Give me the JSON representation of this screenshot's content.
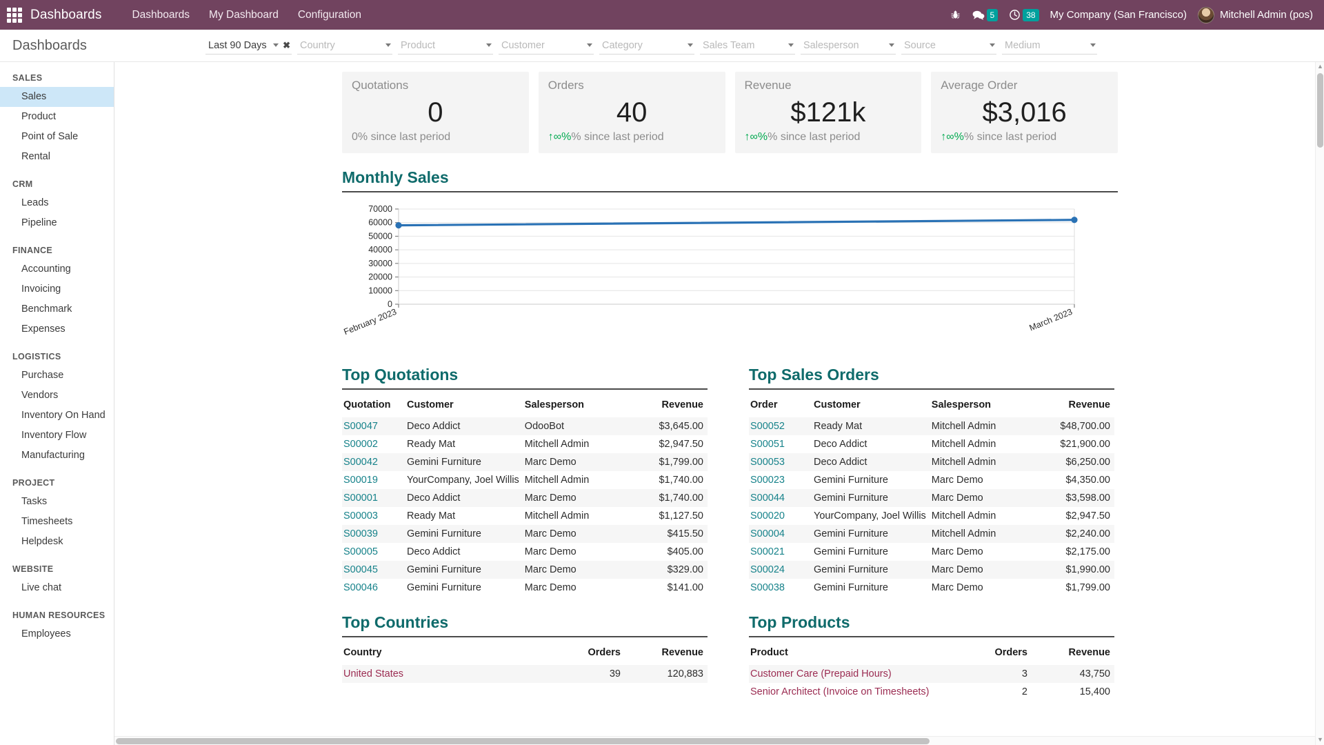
{
  "navbar": {
    "apps_icon": "apps-grid-icon",
    "brand": "Dashboards",
    "menu": [
      {
        "label": "Dashboards"
      },
      {
        "label": "My Dashboard"
      },
      {
        "label": "Configuration"
      }
    ],
    "bug_icon": "bug-icon",
    "messages_icon": "chat-bubble-icon",
    "messages_count": "5",
    "activities_icon": "clock-icon",
    "activities_count": "38",
    "company": "My Company (San Francisco)",
    "user": "Mitchell Admin (pos)",
    "avatar_icon": "user-avatar",
    "accent": "#71435f",
    "badge_color": "#00a09d"
  },
  "controlbar": {
    "title": "Dashboards",
    "period": {
      "value": "Last 90 Days"
    },
    "filters": [
      {
        "placeholder": "Country"
      },
      {
        "placeholder": "Product"
      },
      {
        "placeholder": "Customer"
      },
      {
        "placeholder": "Category"
      },
      {
        "placeholder": "Sales Team"
      },
      {
        "placeholder": "Salesperson"
      },
      {
        "placeholder": "Source"
      },
      {
        "placeholder": "Medium"
      }
    ]
  },
  "sidebar": {
    "groups": [
      {
        "label": "SALES",
        "items": [
          {
            "label": "Sales",
            "active": true
          },
          {
            "label": "Product",
            "active": false
          },
          {
            "label": "Point of Sale",
            "active": false
          },
          {
            "label": "Rental",
            "active": false
          }
        ]
      },
      {
        "label": "CRM",
        "items": [
          {
            "label": "Leads",
            "active": false
          },
          {
            "label": "Pipeline",
            "active": false
          }
        ]
      },
      {
        "label": "FINANCE",
        "items": [
          {
            "label": "Accounting",
            "active": false
          },
          {
            "label": "Invoicing",
            "active": false
          },
          {
            "label": "Benchmark",
            "active": false
          },
          {
            "label": "Expenses",
            "active": false
          }
        ]
      },
      {
        "label": "LOGISTICS",
        "items": [
          {
            "label": "Purchase",
            "active": false
          },
          {
            "label": "Vendors",
            "active": false
          },
          {
            "label": "Inventory On Hand",
            "active": false
          },
          {
            "label": "Inventory Flow",
            "active": false
          },
          {
            "label": "Manufacturing",
            "active": false
          }
        ]
      },
      {
        "label": "PROJECT",
        "items": [
          {
            "label": "Tasks",
            "active": false
          },
          {
            "label": "Timesheets",
            "active": false
          },
          {
            "label": "Helpdesk",
            "active": false
          }
        ]
      },
      {
        "label": "WEBSITE",
        "items": [
          {
            "label": "Live chat",
            "active": false
          }
        ]
      },
      {
        "label": "HUMAN RESOURCES",
        "items": [
          {
            "label": "Employees",
            "active": false
          }
        ]
      }
    ]
  },
  "kpis": [
    {
      "label": "Quotations",
      "value": "0",
      "delta": "0% since last period",
      "arrow": "",
      "positive": false
    },
    {
      "label": "Orders",
      "value": "40",
      "delta": "% since last period",
      "arrow": "↑∞",
      "positive": true
    },
    {
      "label": "Revenue",
      "value": "$121k",
      "delta": "% since last period",
      "arrow": "↑∞",
      "positive": true
    },
    {
      "label": "Average Order",
      "value": "$3,016",
      "delta": "% since last period",
      "arrow": "↑∞",
      "positive": true
    }
  ],
  "chart_data": {
    "type": "line",
    "title": "Monthly Sales",
    "x": [
      "February 2023",
      "March 2023"
    ],
    "categories": [
      "February 2023",
      "March 2023"
    ],
    "values": [
      58000,
      62000
    ],
    "series": [
      {
        "name": "Monthly Sales",
        "values": [
          58000,
          62000
        ]
      }
    ],
    "xlabel": "",
    "ylabel": "",
    "ylim": [
      0,
      70000
    ],
    "yticks": [
      0,
      10000,
      20000,
      30000,
      40000,
      50000,
      60000,
      70000
    ],
    "ytick_labels": [
      "0",
      "10000",
      "20000",
      "30000",
      "40000",
      "50000",
      "60000",
      "70000"
    ],
    "grid": true,
    "legend": false,
    "line_color": "#2a72b5",
    "marker": "circle"
  },
  "top_quotations": {
    "title": "Top Quotations",
    "columns": [
      "Quotation",
      "Customer",
      "Salesperson",
      "Revenue"
    ],
    "rows": [
      {
        "ref": "S00047",
        "customer": "Deco Addict",
        "salesperson": "OdooBot",
        "revenue": "$3,645.00"
      },
      {
        "ref": "S00002",
        "customer": "Ready Mat",
        "salesperson": "Mitchell Admin",
        "revenue": "$2,947.50"
      },
      {
        "ref": "S00042",
        "customer": "Gemini Furniture",
        "salesperson": "Marc Demo",
        "revenue": "$1,799.00"
      },
      {
        "ref": "S00019",
        "customer": "YourCompany, Joel Willis",
        "salesperson": "Mitchell Admin",
        "revenue": "$1,740.00"
      },
      {
        "ref": "S00001",
        "customer": "Deco Addict",
        "salesperson": "Marc Demo",
        "revenue": "$1,740.00"
      },
      {
        "ref": "S00003",
        "customer": "Ready Mat",
        "salesperson": "Mitchell Admin",
        "revenue": "$1,127.50"
      },
      {
        "ref": "S00039",
        "customer": "Gemini Furniture",
        "salesperson": "Marc Demo",
        "revenue": "$415.50"
      },
      {
        "ref": "S00005",
        "customer": "Deco Addict",
        "salesperson": "Marc Demo",
        "revenue": "$405.00"
      },
      {
        "ref": "S00045",
        "customer": "Gemini Furniture",
        "salesperson": "Marc Demo",
        "revenue": "$329.00"
      },
      {
        "ref": "S00046",
        "customer": "Gemini Furniture",
        "salesperson": "Marc Demo",
        "revenue": "$141.00"
      }
    ]
  },
  "top_sales_orders": {
    "title": "Top Sales Orders",
    "columns": [
      "Order",
      "Customer",
      "Salesperson",
      "Revenue"
    ],
    "rows": [
      {
        "ref": "S00052",
        "customer": "Ready Mat",
        "salesperson": "Mitchell Admin",
        "revenue": "$48,700.00"
      },
      {
        "ref": "S00051",
        "customer": "Deco Addict",
        "salesperson": "Mitchell Admin",
        "revenue": "$21,900.00"
      },
      {
        "ref": "S00053",
        "customer": "Deco Addict",
        "salesperson": "Mitchell Admin",
        "revenue": "$6,250.00"
      },
      {
        "ref": "S00023",
        "customer": "Gemini Furniture",
        "salesperson": "Marc Demo",
        "revenue": "$4,350.00"
      },
      {
        "ref": "S00044",
        "customer": "Gemini Furniture",
        "salesperson": "Marc Demo",
        "revenue": "$3,598.00"
      },
      {
        "ref": "S00020",
        "customer": "YourCompany, Joel Willis",
        "salesperson": "Mitchell Admin",
        "revenue": "$2,947.50"
      },
      {
        "ref": "S00004",
        "customer": "Gemini Furniture",
        "salesperson": "Mitchell Admin",
        "revenue": "$2,240.00"
      },
      {
        "ref": "S00021",
        "customer": "Gemini Furniture",
        "salesperson": "Marc Demo",
        "revenue": "$2,175.00"
      },
      {
        "ref": "S00024",
        "customer": "Gemini Furniture",
        "salesperson": "Marc Demo",
        "revenue": "$1,990.00"
      },
      {
        "ref": "S00038",
        "customer": "Gemini Furniture",
        "salesperson": "Marc Demo",
        "revenue": "$1,799.00"
      }
    ]
  },
  "top_countries": {
    "title": "Top Countries",
    "columns": [
      "Country",
      "Orders",
      "Revenue"
    ],
    "rows": [
      {
        "name": "United States",
        "orders": "39",
        "revenue": "120,883"
      }
    ]
  },
  "top_products": {
    "title": "Top Products",
    "columns": [
      "Product",
      "Orders",
      "Revenue"
    ],
    "rows": [
      {
        "name": "Customer Care (Prepaid Hours)",
        "orders": "3",
        "revenue": "43,750"
      },
      {
        "name": "Senior Architect (Invoice on Timesheets)",
        "orders": "2",
        "revenue": "15,400"
      }
    ]
  }
}
